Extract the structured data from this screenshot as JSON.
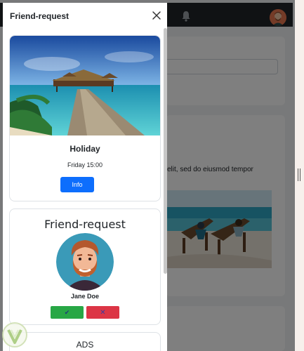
{
  "background_page": {
    "text_snippet": "elit, sed do eiusmod tempor",
    "icons": [
      "bell-icon",
      "user-avatar"
    ]
  },
  "offcanvas": {
    "title": "Friend-request",
    "close_icon": "close-icon"
  },
  "event_card": {
    "title": "Holiday",
    "time": "Friday 15:00",
    "button_label": "Info"
  },
  "request_card": {
    "title": "Friend-request",
    "name": "Jane Doe",
    "accept_label": "✔",
    "decline_label": "✕"
  },
  "ads_card": {
    "title": "ADS"
  },
  "colors": {
    "primary": "#0d6efd",
    "success": "#28a745",
    "danger": "#dc3545",
    "navbar": "#212529"
  }
}
